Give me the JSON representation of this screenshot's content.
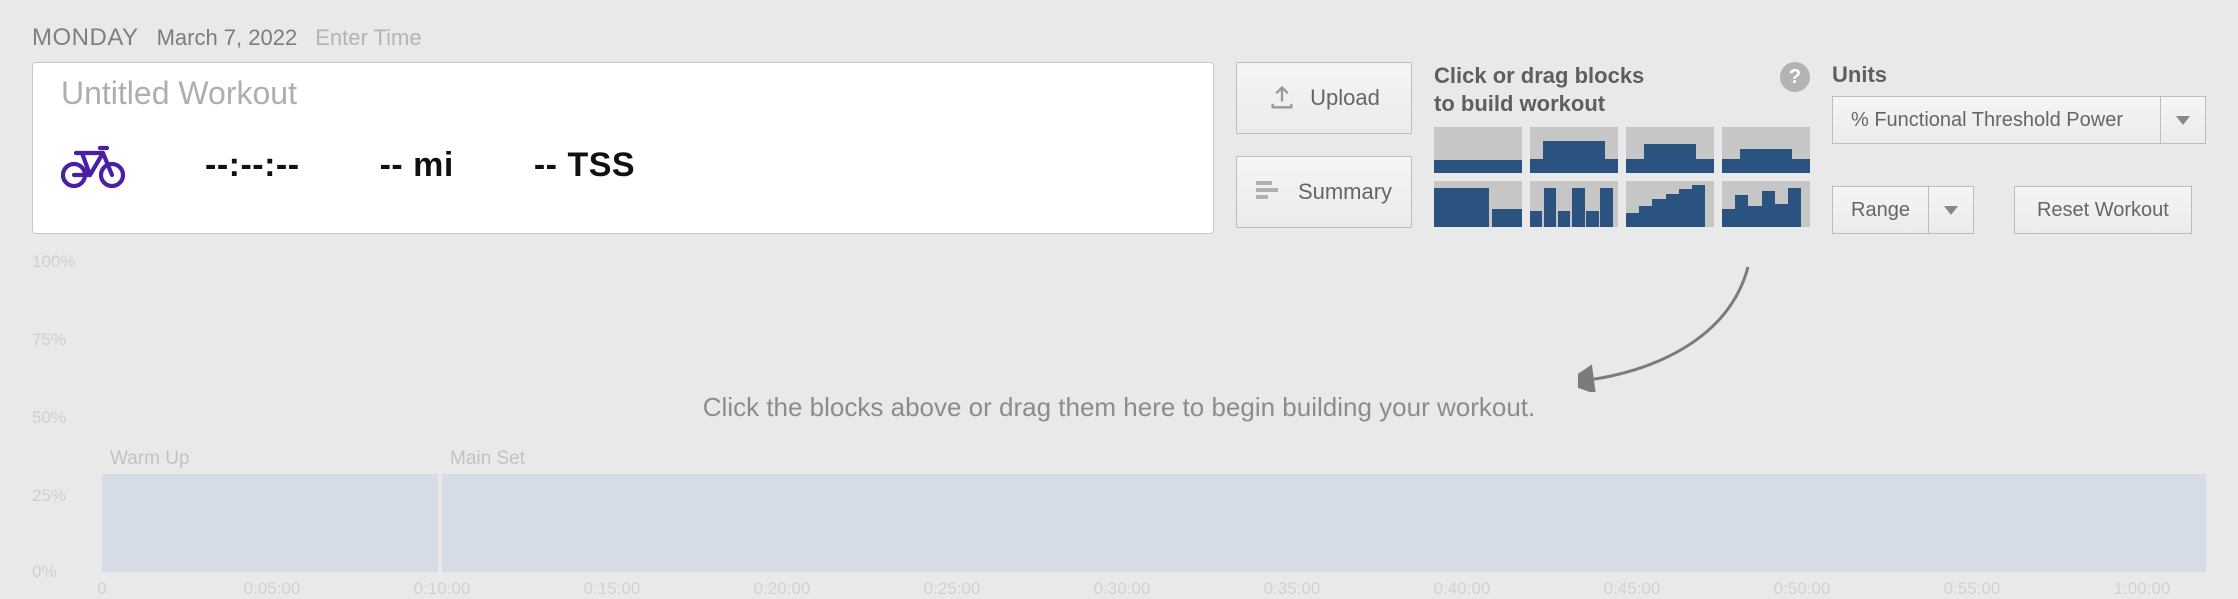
{
  "header": {
    "day": "MONDAY",
    "date": "March 7, 2022",
    "enter_time": "Enter Time"
  },
  "workout": {
    "title_placeholder": "Untitled Workout",
    "duration": "--:--:--",
    "distance": "-- mi",
    "tss": "-- TSS"
  },
  "buttons": {
    "upload": "Upload",
    "summary": "Summary"
  },
  "palette": {
    "title_line1": "Click or drag blocks",
    "title_line2": "to build workout"
  },
  "units": {
    "label": "Units",
    "selected": "% Functional Threshold Power",
    "range_label": "Range",
    "reset_label": "Reset Workout"
  },
  "chart_data": {
    "type": "bar",
    "ylabels": [
      "100%",
      "75%",
      "50%",
      "25%",
      "0%"
    ],
    "xticks": [
      "0",
      "0:05:00",
      "0:10:00",
      "0:15:00",
      "0:20:00",
      "0:25:00",
      "0:30:00",
      "0:35:00",
      "0:40:00",
      "0:45:00",
      "0:50:00",
      "0:55:00",
      "1:00:00"
    ],
    "segments": [
      {
        "label": "Warm Up",
        "start": "0",
        "end": "0:10:00",
        "value_pct": 25
      },
      {
        "label": "Main Set",
        "start": "0:10:00",
        "end": "1:00:00",
        "value_pct": 25
      }
    ],
    "ylim": [
      0,
      100
    ],
    "hint": "Click the blocks above or drag them here to begin building your workout."
  }
}
